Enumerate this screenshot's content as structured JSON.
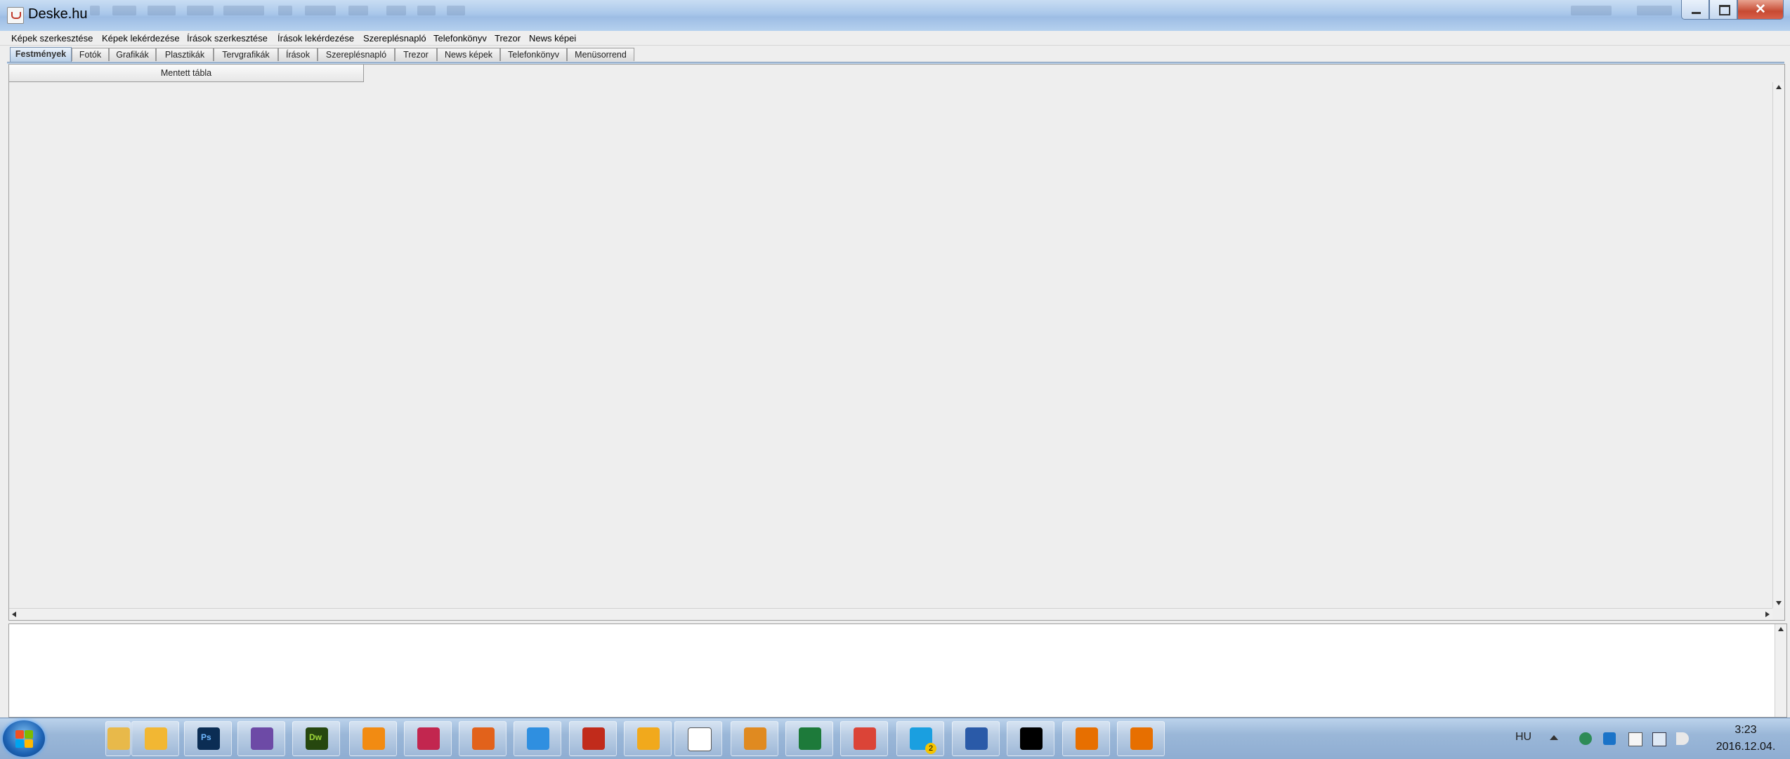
{
  "window": {
    "title": "Deske.hu",
    "buttons": {
      "minimize": "–",
      "maximize": "□",
      "close": "✕"
    }
  },
  "menu": [
    "Képek szerkesztése",
    "Képek lekérdezése",
    "Írások szerkesztése",
    "Írások lekérdezése",
    "Szereplésnapló",
    "Telefonkönyv",
    "Trezor",
    "News képei"
  ],
  "tabs": [
    "Festmények",
    "Fotók",
    "Grafikák",
    "Plasztikák",
    "Tervgrafikák",
    "Írások",
    "Szereplésnapló",
    "Trezor",
    "News képek",
    "Telefonkönyv",
    "Menüsorrend"
  ],
  "active_tab": "Festmények",
  "table": {
    "columns": [
      "Mentett tábla"
    ],
    "rows": []
  },
  "taskbar": {
    "apps": [
      {
        "name": "explorer-icon",
        "color": "#e8b94a"
      },
      {
        "name": "outlook-icon",
        "color": "#f2b733"
      },
      {
        "name": "photoshop-icon",
        "color": "#0b2d54",
        "label": "Ps"
      },
      {
        "name": "visual-studio-icon",
        "color": "#6d4aa6"
      },
      {
        "name": "dreamweaver-icon",
        "color": "#26470f",
        "label": "Dw"
      },
      {
        "name": "vlc-icon",
        "color": "#f28b12"
      },
      {
        "name": "floppy-save-icon",
        "color": "#c2264f"
      },
      {
        "name": "firefox-icon",
        "color": "#e2621b"
      },
      {
        "name": "internet-explorer-icon",
        "color": "#2f8fe0"
      },
      {
        "name": "filezilla-icon",
        "color": "#c12b1b"
      },
      {
        "name": "vectorworks-icon",
        "color": "#f1a91c"
      },
      {
        "name": "calendar-icon",
        "color": "#ffffff"
      },
      {
        "name": "xnview-icon",
        "color": "#e08a20"
      },
      {
        "name": "excel-icon",
        "color": "#1d7a3a"
      },
      {
        "name": "chrome-icon",
        "color": "#db4437"
      },
      {
        "name": "skype-icon",
        "color": "#1a9fe0",
        "badge": "2"
      },
      {
        "name": "network-icon",
        "color": "#2a5aa8"
      },
      {
        "name": "terminal-icon",
        "color": "#000000"
      },
      {
        "name": "java-icon",
        "color": "#e76f00"
      },
      {
        "name": "java-icon",
        "color": "#e76f00"
      }
    ],
    "tray": {
      "language": "HU",
      "time": "3:23",
      "date": "2016.12.04."
    }
  }
}
